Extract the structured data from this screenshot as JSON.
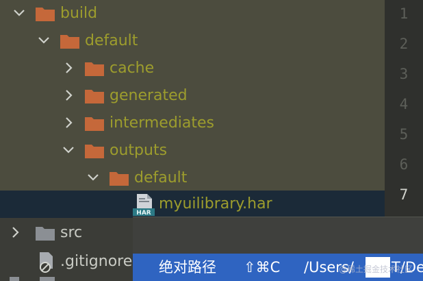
{
  "tree": {
    "items": [
      {
        "label": "build"
      },
      {
        "label": "default"
      },
      {
        "label": "cache"
      },
      {
        "label": "generated"
      },
      {
        "label": "intermediates"
      },
      {
        "label": "outputs"
      },
      {
        "label": "default"
      },
      {
        "label": "myuilibrary.har",
        "icon_text": "HAR"
      },
      {
        "label": "src"
      },
      {
        "label": ".gitignore"
      }
    ]
  },
  "gutter": {
    "line_numbers": [
      "1",
      "2",
      "3",
      "4",
      "5",
      "6",
      "7"
    ],
    "active_line": "7"
  },
  "context_menu": {
    "item_label": "绝对路径",
    "shortcut": "⇧⌘C",
    "path_prefix": "/Users/",
    "path_suffix": "T/Des"
  },
  "watermark": "@稀土掘金技术社区",
  "colors": {
    "folder": "#c5683a",
    "label": "#9d9d2d",
    "selection": "#1b2a38",
    "menu_highlight": "#2f64c1"
  }
}
